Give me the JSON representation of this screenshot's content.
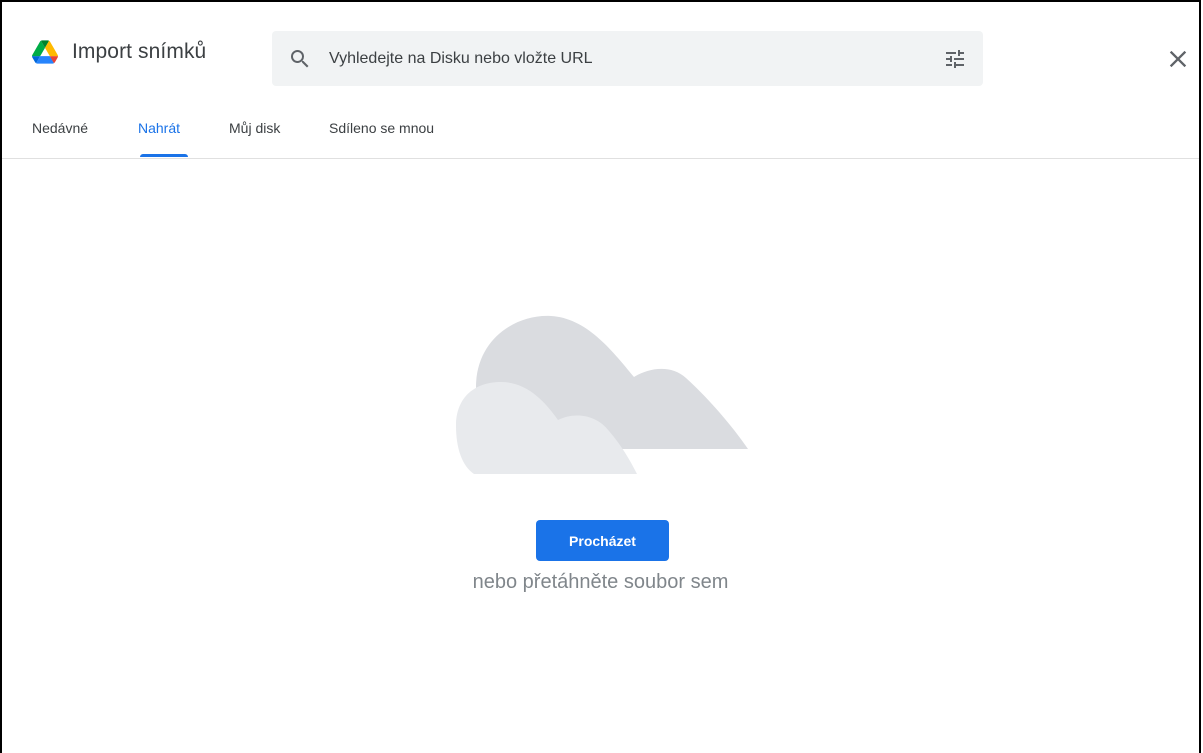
{
  "header": {
    "title": "Import snímků",
    "logo_icon": "google-drive-icon"
  },
  "search": {
    "placeholder": "Vyhledejte na Disku nebo vložte URL",
    "value": "",
    "search_icon": "search-icon",
    "filter_icon": "tune-icon"
  },
  "close_icon": "close-icon",
  "tabs": [
    {
      "label": "Nedávné",
      "active": false
    },
    {
      "label": "Nahrát",
      "active": true
    },
    {
      "label": "Můj disk",
      "active": false
    },
    {
      "label": "Sdíleno se mnou",
      "active": false
    }
  ],
  "upload": {
    "illustration": "clouds-illustration",
    "browse_label": "Procházet",
    "drop_hint": "nebo přetáhněte soubor sem"
  },
  "colors": {
    "accent": "#1a73e8",
    "cloud_back": "#dadce0",
    "cloud_front": "#e8eaed"
  }
}
